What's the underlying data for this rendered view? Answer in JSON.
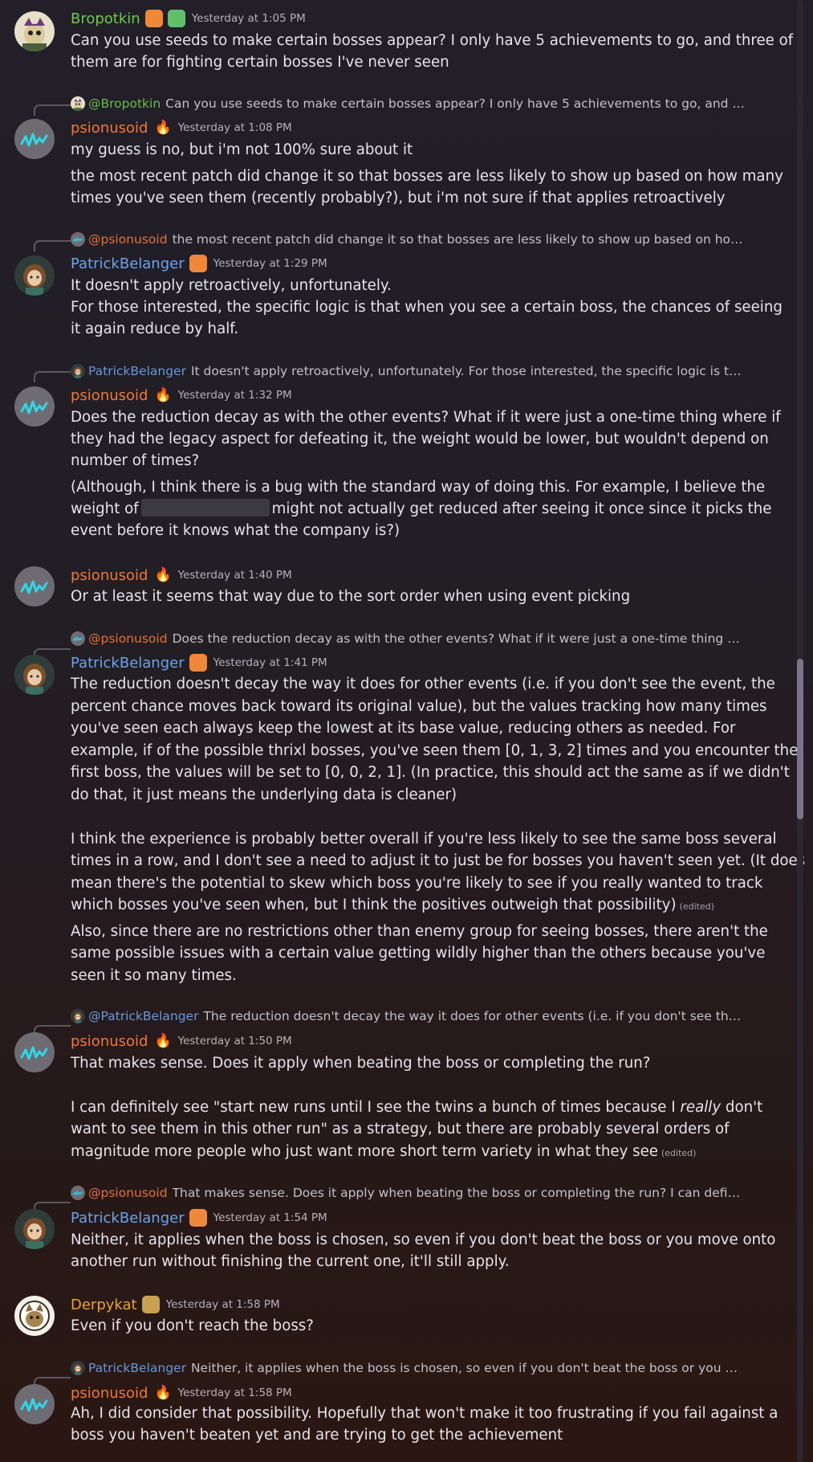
{
  "colors": {
    "Bropotkin": "#6ec94a",
    "psionusoid": "#f07838",
    "PatrickBelanger": "#6aa3ea",
    "Derpykat": "#eaa42c"
  },
  "messages": [
    {
      "author": "Bropotkin",
      "timestamp": "Yesterday at 1:05 PM",
      "lines": [
        "Can you use seeds to make certain bosses appear? I only have 5 achievements to go, and three of",
        "them are for fighting certain bosses I've never seen"
      ]
    },
    {
      "reply_mention": "@Bropotkin",
      "reply_text": "Can you use seeds to make certain bosses appear? I only have 5 achievements to go, and three ...",
      "author": "psionusoid",
      "timestamp": "Yesterday at 1:08 PM",
      "lines": [
        "my guess is no, but i'm not 100% sure about it",
        "the most recent patch did change it so that bosses are less likely to show up based on how many",
        "times you've seen them (recently probably?), but i'm not sure if that applies retroactively"
      ]
    },
    {
      "reply_mention": "@psionusoid",
      "reply_text": "the most recent patch did change it so that bosses are less likely to show up based on how ma...",
      "author": "PatrickBelanger",
      "timestamp": "Yesterday at 1:29 PM",
      "lines": [
        "It doesn't apply retroactively, unfortunately.",
        "For those interested, the specific logic is that when you see a certain boss, the chances of seeing",
        "it again reduce by half."
      ]
    },
    {
      "reply_mention": "PatrickBelanger",
      "reply_text": "It doesn't apply retroactively, unfortunately.  For those interested, the specific logic is that ...",
      "author": "psionusoid",
      "timestamp": "Yesterday at 1:32 PM",
      "lines": [
        "Does the reduction decay as with the other events? What if it were just a one-time thing where if",
        "they had the legacy aspect for defeating it, the weight would be lower, but wouldn't depend on",
        "number of times?",
        "(Although, I think there is a bug with the standard way of doing this. For example, I believe the",
        "weight of",
        "might not actually get reduced after seeing it once since it picks the",
        "event before it knows what the company is?)"
      ]
    },
    {
      "author": "psionusoid",
      "timestamp": "Yesterday at 1:40 PM",
      "lines": [
        "Or at least it seems that way due to the sort order when using event picking"
      ]
    },
    {
      "reply_mention": "@psionusoid",
      "reply_text": "Does the reduction decay as with the other events? What if it were just a one-time thing wher...",
      "author": "PatrickBelanger",
      "timestamp": "Yesterday at 1:41 PM",
      "lines": [
        "The reduction doesn't decay the way it does for other events (i.e. if you don't see the event, the",
        "percent chance moves back toward its original value), but the values tracking how many times",
        "you've seen each always keep the lowest at its base value, reducing others as needed. For",
        "example, if of the possible thrixl bosses, you've seen them [0, 1, 3, 2] times and you encounter the",
        "first boss, the values will be set to [0, 0, 2, 1]. (In practice, this should act the same as if we didn't",
        "do that, it just means the underlying data is cleaner)",
        "I think the experience is probably better overall if you're less likely to see the same boss several",
        "times in a row, and I don't see a need to adjust it to just be for bosses you haven't seen yet. (It does",
        "mean there's the potential to skew which boss you're likely to see if you really wanted to track",
        "which bosses you've seen when, but I think the positives outweigh that possibility)",
        "Also, since there are no restrictions other than enemy group for seeing bosses, there aren't the",
        "same possible issues with a certain value getting wildly higher than the others because you've",
        "seen it so many times."
      ],
      "edited_label": "(edited)"
    },
    {
      "reply_mention": "@PatrickBelanger",
      "reply_text": "The reduction doesn't decay the way it does for other events (i.e. if you don't see the eve...",
      "author": "psionusoid",
      "timestamp": "Yesterday at 1:50 PM",
      "lines": [
        "That makes sense. Does it apply when beating the boss or completing the run?",
        "I can definitely see \"start new runs until I see the twins a bunch of times because I",
        "really",
        "don't",
        "want to see them in this other run\" as a strategy, but there are probably several orders of",
        "magnitude more people who just want more short term variety in what they see"
      ],
      "edited_label": "(edited)"
    },
    {
      "reply_mention": "@psionusoid",
      "reply_text": "That makes sense. Does it apply when beating the boss or completing the run?  I can definitely ...",
      "author": "PatrickBelanger",
      "timestamp": "Yesterday at 1:54 PM",
      "lines": [
        "Neither, it applies when the boss is chosen, so even if you don't beat the boss or you move onto",
        "another run without finishing the current one, it'll still apply."
      ]
    },
    {
      "author": "Derpykat",
      "timestamp": "Yesterday at 1:58 PM",
      "lines": [
        "Even if you don't reach the boss?"
      ]
    },
    {
      "reply_mention": "PatrickBelanger",
      "reply_text": "Neither, it applies when the boss is chosen, so even if you don't beat the boss or you move o...",
      "author": "psionusoid",
      "timestamp": "Yesterday at 1:58 PM",
      "lines": [
        "Ah, I did consider that possibility. Hopefully that won't make it too frustrating if you fail against a",
        "boss you haven't beaten yet and are trying to get the achievement"
      ]
    }
  ]
}
